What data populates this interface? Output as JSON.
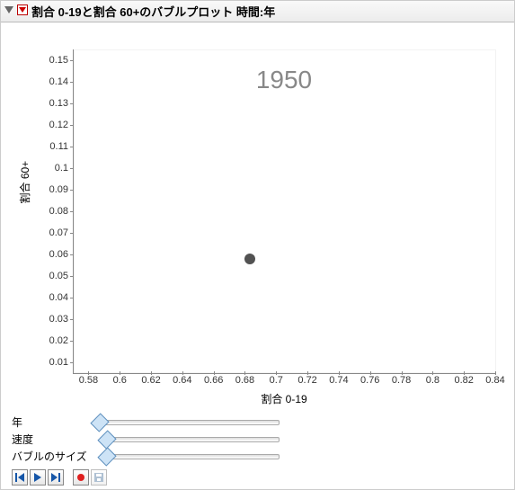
{
  "title": "割合 0-19と割合 60+のバブルプロット  時間:年",
  "chart_data": {
    "type": "scatter",
    "title": "",
    "xlabel": "割合 0-19",
    "ylabel": "割合 60+",
    "year_display": "1950",
    "xlim": [
      0.57,
      0.84
    ],
    "ylim": [
      0.005,
      0.155
    ],
    "x_ticks": [
      0.58,
      0.6,
      0.62,
      0.64,
      0.66,
      0.68,
      0.7,
      0.72,
      0.74,
      0.76,
      0.78,
      0.8,
      0.82,
      0.84
    ],
    "y_ticks": [
      0.01,
      0.02,
      0.03,
      0.04,
      0.05,
      0.06,
      0.07,
      0.08,
      0.09,
      0.1,
      0.11,
      0.12,
      0.13,
      0.14,
      0.15
    ],
    "series": [
      {
        "name": "bubble",
        "x": [
          0.683
        ],
        "y": [
          0.058
        ],
        "size": [
          1
        ]
      }
    ]
  },
  "controls": {
    "year": {
      "label": "年",
      "position": 0.0
    },
    "speed": {
      "label": "速度",
      "position": 0.04
    },
    "bubble_size": {
      "label": "バブルのサイズ",
      "position": 0.04
    }
  },
  "buttons": {
    "step_back": "step-back",
    "play": "play",
    "step_fwd": "step-forward",
    "record": "record",
    "save": "save"
  },
  "colors": {
    "bubble": "#525252",
    "year_text": "#888888"
  }
}
